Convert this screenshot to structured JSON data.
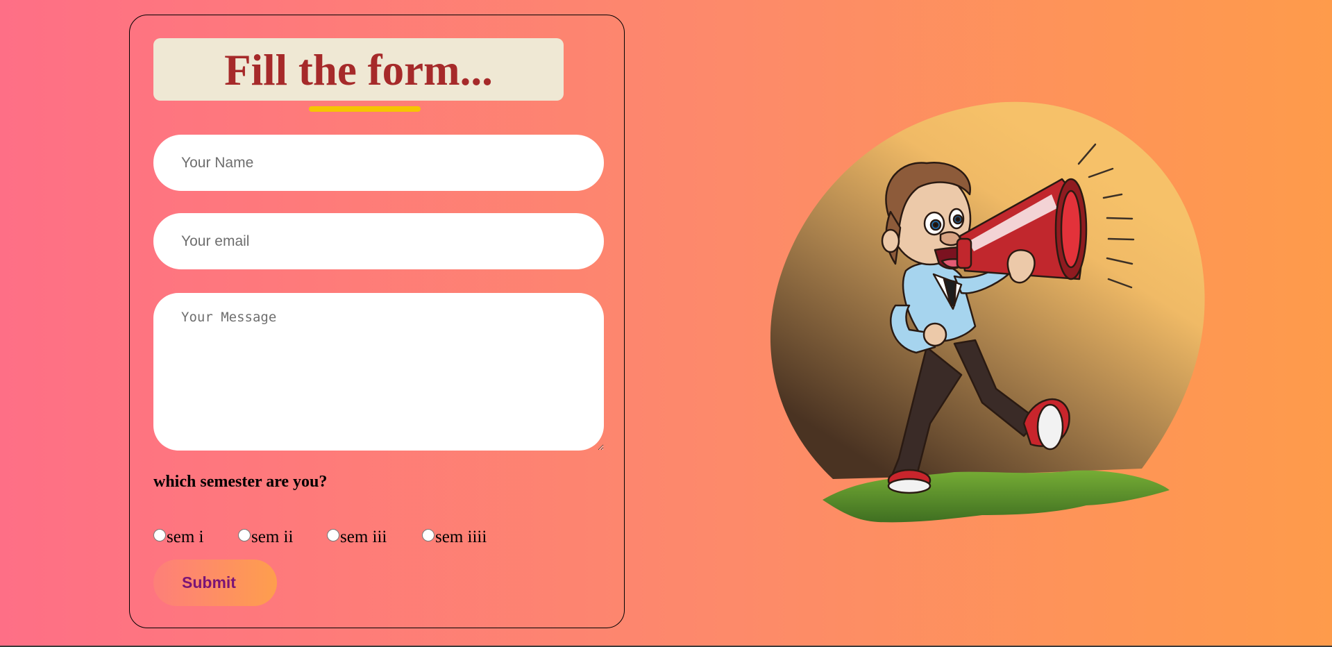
{
  "form": {
    "title": "Fill the form...",
    "name_placeholder": "Your Name",
    "email_placeholder": "Your email",
    "message_placeholder": "Your Message",
    "semester_question": "which semester are you?",
    "semester_options": [
      "sem i",
      "sem ii",
      "sem iii",
      "sem iiii"
    ],
    "submit_label": "Submit"
  },
  "illustration": {
    "subject": "megaphone-man-icon",
    "colors": {
      "circle_light": "#f6c169",
      "circle_dark": "#4a3322",
      "grass": "#5f962d",
      "megaphone": "#c1272d",
      "shirt": "#a6d4ee"
    }
  },
  "theme": {
    "title_color": "#a62a2a",
    "title_bg": "#efe8d4",
    "underline_color": "#f5c500",
    "submit_text_color": "#7a1476"
  }
}
